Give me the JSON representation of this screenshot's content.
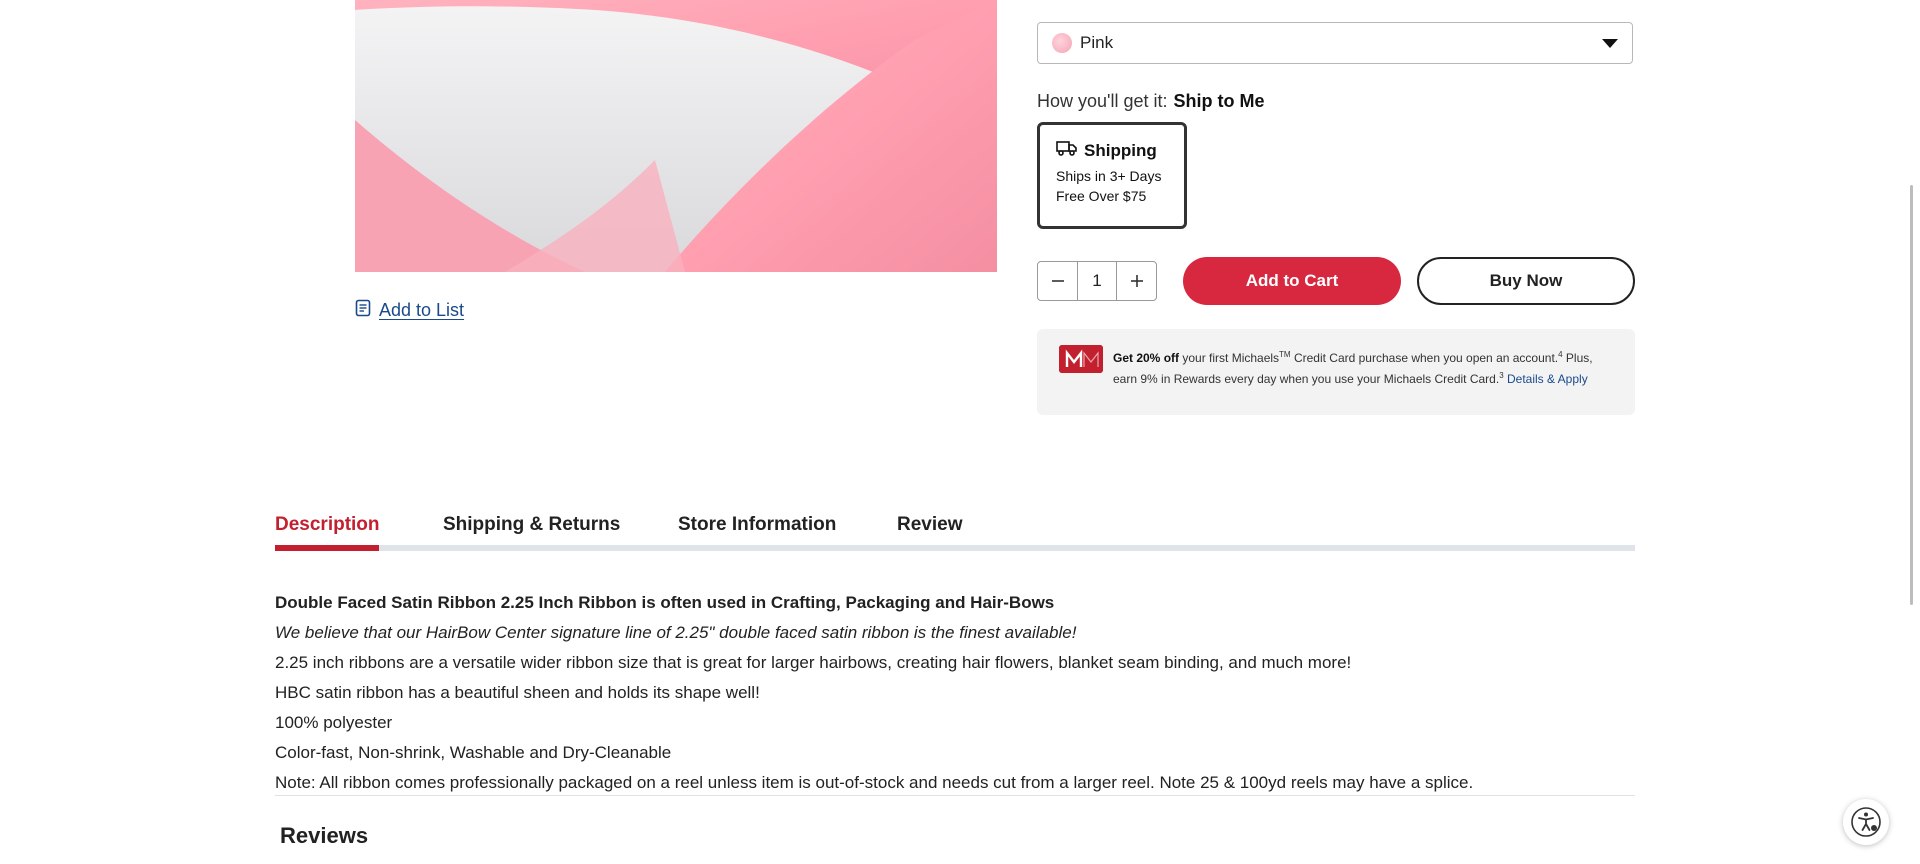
{
  "product": {
    "image_alt": "Pink satin ribbon on a reel",
    "add_to_list_label": "Add to List"
  },
  "variant": {
    "selected": "Pink"
  },
  "fulfilment": {
    "label": "How you'll get it:",
    "method": "Ship to Me",
    "option_title": "Shipping",
    "option_line1": "Ships in 3+ Days",
    "option_line2": "Free Over $75"
  },
  "quantity": {
    "value": "1"
  },
  "actions": {
    "add_to_cart": "Add to Cart",
    "buy_now": "Buy Now"
  },
  "promo": {
    "bold": "Get 20% off",
    "text1": " your first Michaels",
    "tm": "TM",
    "text2": " Credit Card purchase when you open an account.",
    "sup1": "4",
    "text3": " Plus, earn 9% in Rewards every day when you use your Michaels Credit Card.",
    "sup2": "3",
    "link": "Details & Apply"
  },
  "tabs": [
    {
      "label": "Description"
    },
    {
      "label": "Shipping & Returns"
    },
    {
      "label": "Store Information"
    },
    {
      "label": "Review"
    }
  ],
  "description": {
    "heading": "Double Faced Satin Ribbon 2.25 Inch Ribbon is often used in Crafting, Packaging and Hair-Bows",
    "tagline": "We believe that our HairBow Center signature line of 2.25\" double faced satin ribbon is the finest available!",
    "lines": [
      "2.25 inch ribbons are a versatile wider ribbon size that is great for larger hairbows, creating hair flowers, blanket seam binding, and much more!",
      "HBC satin ribbon has a beautiful sheen and holds its shape well!",
      "100% polyester",
      "Color-fast, Non-shrink, Washable and Dry-Cleanable",
      "Note: All ribbon comes professionally packaged on a reel unless item is out-of-stock and needs cut from a larger reel. Note 25 & 100yd reels may have a splice."
    ]
  },
  "reviews": {
    "title": "Reviews"
  },
  "colors": {
    "brand_red": "#d7283f",
    "active_tab": "#c3202f",
    "link": "#1a4a8c"
  },
  "icons": {
    "add_to_list": "list-icon",
    "shipping": "truck-icon",
    "accessibility": "accessibility-icon"
  }
}
